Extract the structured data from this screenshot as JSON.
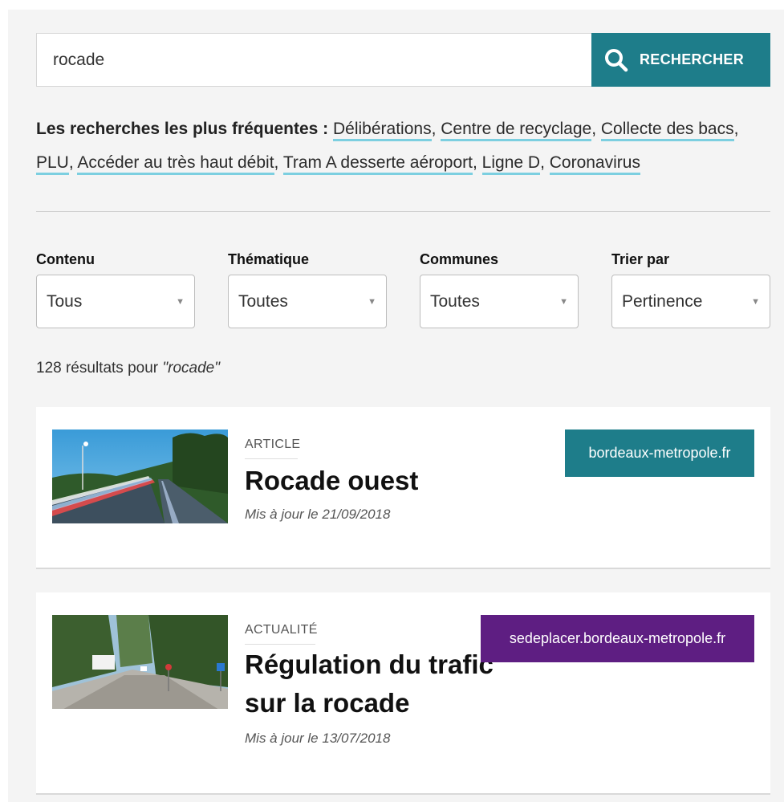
{
  "search": {
    "value": "rocade",
    "button_label": "RECHERCHER"
  },
  "frequent": {
    "label": "Les recherches les plus fréquentes :",
    "items": [
      "Délibérations",
      "Centre de recyclage",
      "Collecte des bacs",
      "PLU",
      "Accéder au très haut débit",
      "Tram A desserte aéroport",
      "Ligne D",
      "Coronavirus"
    ]
  },
  "filters": [
    {
      "label": "Contenu",
      "value": "Tous"
    },
    {
      "label": "Thématique",
      "value": "Toutes"
    },
    {
      "label": "Communes",
      "value": "Toutes"
    },
    {
      "label": "Trier par",
      "value": "Pertinence"
    }
  ],
  "results": {
    "count_text": "128 résultats pour",
    "query_text": "\"rocade\""
  },
  "cards": [
    {
      "type": "ARTICLE",
      "title": "Rocade ouest",
      "date": "Mis à jour le 21/09/2018",
      "source": "bordeaux-metropole.fr",
      "source_color": "#1e7d8a"
    },
    {
      "type": "ACTUALITÉ",
      "title": "Régulation du trafic sur la rocade",
      "date": "Mis à jour le 13/07/2018",
      "source": "sedeplacer.bordeaux-metropole.fr",
      "source_color": "#5e1e82"
    }
  ],
  "icons": {
    "search": "search-icon",
    "caret": "chevron-down-icon"
  }
}
